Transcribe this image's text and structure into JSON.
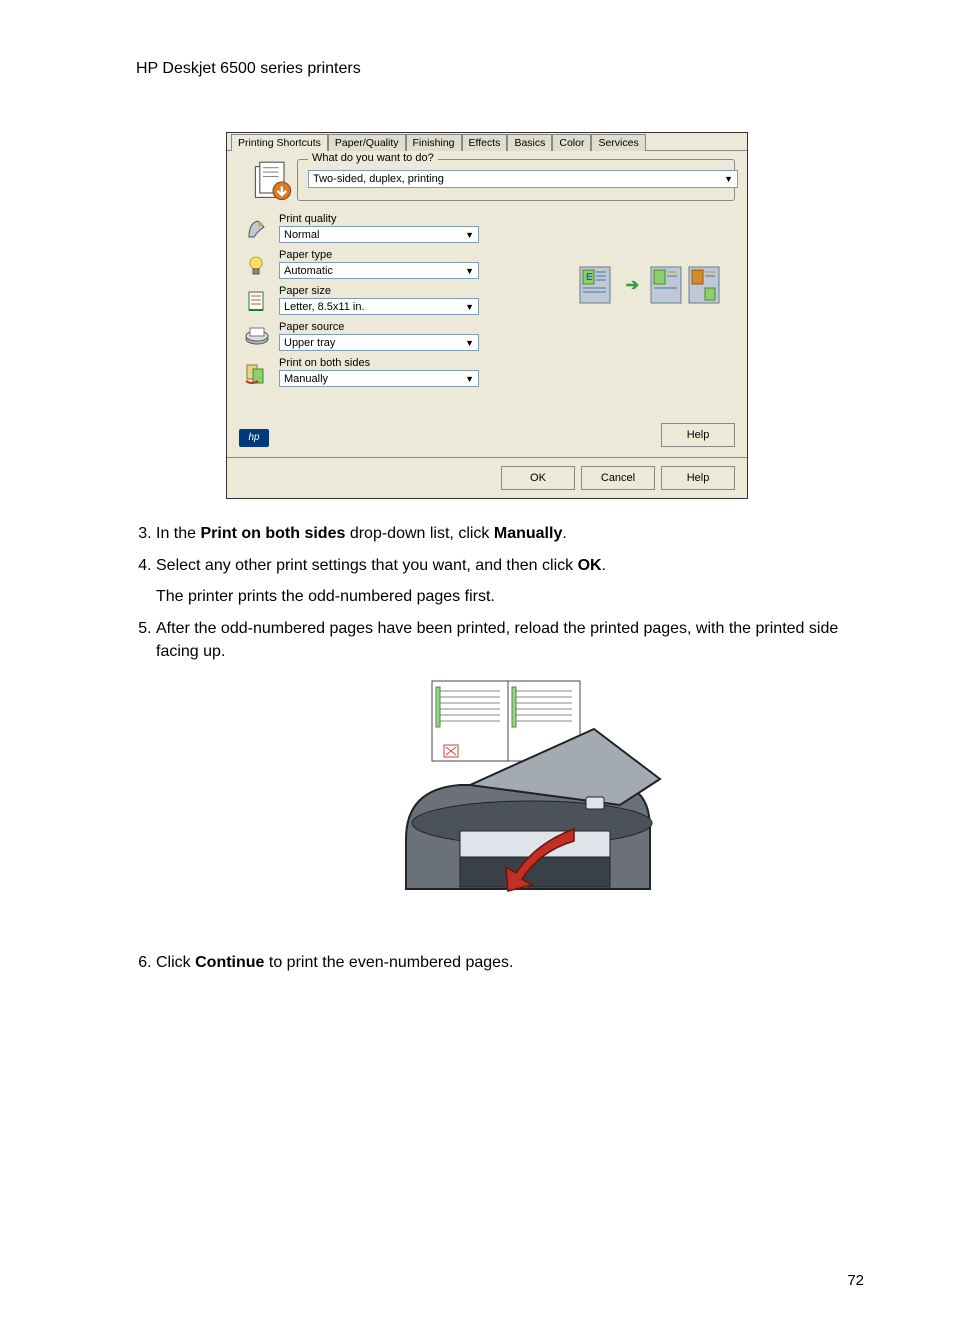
{
  "header": "HP Deskjet 6500 series printers",
  "dialog": {
    "tabs": [
      "Printing Shortcuts",
      "Paper/Quality",
      "Finishing",
      "Effects",
      "Basics",
      "Color",
      "Services"
    ],
    "active_tab_index": 0,
    "what_legend": "What do you want to do?",
    "task_value": "Two-sided, duplex, printing",
    "settings": {
      "print_quality": {
        "label": "Print quality",
        "value": "Normal"
      },
      "paper_type": {
        "label": "Paper type",
        "value": "Automatic"
      },
      "paper_size": {
        "label": "Paper size",
        "value": "Letter, 8.5x11 in."
      },
      "paper_source": {
        "label": "Paper source",
        "value": "Upper tray"
      },
      "both_sides": {
        "label": "Print on both sides",
        "value": "Manually"
      }
    },
    "hp_logo": "hp",
    "help": "Help",
    "ok": "OK",
    "cancel": "Cancel",
    "help2": "Help"
  },
  "steps": {
    "s3a": "In the ",
    "s3b": "Print on both sides",
    "s3c": " drop-down list, click ",
    "s3d": "Manually",
    "s3e": ".",
    "s4a": "Select any other print settings that you want, and then click ",
    "s4b": "OK",
    "s4c": ".",
    "s4p": "The printer prints the odd-numbered pages first.",
    "s5": "After the odd-numbered pages have been printed, reload the printed pages, with the printed side facing up.",
    "s6a": "Click ",
    "s6b": "Continue",
    "s6c": " to print the even-numbered pages."
  },
  "page_number": "72"
}
